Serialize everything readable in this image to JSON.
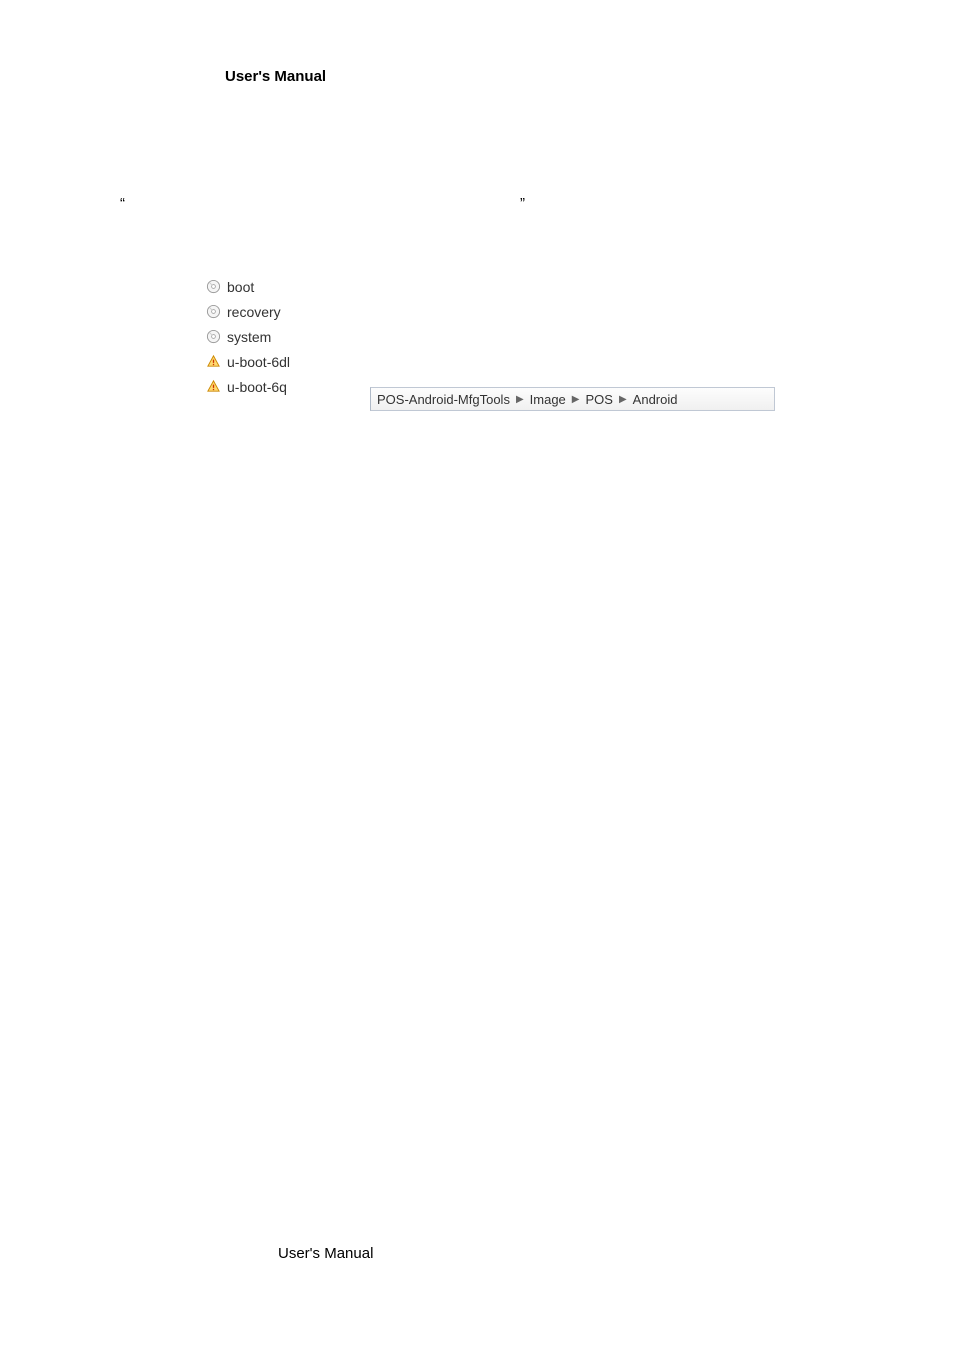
{
  "header": {
    "title": "User's Manual"
  },
  "quotes": {
    "left": "“",
    "right": "”"
  },
  "files": {
    "items": [
      {
        "name": "boot",
        "icon": "disc"
      },
      {
        "name": "recovery",
        "icon": "disc"
      },
      {
        "name": "system",
        "icon": "disc"
      },
      {
        "name": "u-boot-6dl",
        "icon": "warn"
      },
      {
        "name": "u-boot-6q",
        "icon": "warn"
      }
    ]
  },
  "breadcrumb": {
    "segments": [
      "POS-Android-MfgTools",
      "Image",
      "POS",
      "Android"
    ]
  },
  "footer": {
    "title": "User's Manual"
  }
}
